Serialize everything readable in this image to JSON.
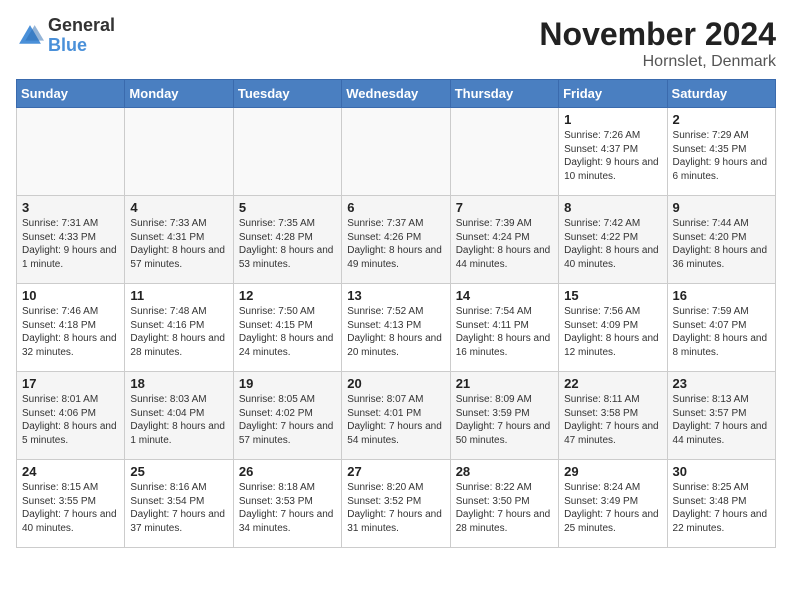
{
  "logo": {
    "general": "General",
    "blue": "Blue"
  },
  "title": "November 2024",
  "location": "Hornslet, Denmark",
  "weekdays": [
    "Sunday",
    "Monday",
    "Tuesday",
    "Wednesday",
    "Thursday",
    "Friday",
    "Saturday"
  ],
  "weeks": [
    [
      {
        "day": "",
        "info": ""
      },
      {
        "day": "",
        "info": ""
      },
      {
        "day": "",
        "info": ""
      },
      {
        "day": "",
        "info": ""
      },
      {
        "day": "",
        "info": ""
      },
      {
        "day": "1",
        "info": "Sunrise: 7:26 AM\nSunset: 4:37 PM\nDaylight: 9 hours and 10 minutes."
      },
      {
        "day": "2",
        "info": "Sunrise: 7:29 AM\nSunset: 4:35 PM\nDaylight: 9 hours and 6 minutes."
      }
    ],
    [
      {
        "day": "3",
        "info": "Sunrise: 7:31 AM\nSunset: 4:33 PM\nDaylight: 9 hours and 1 minute."
      },
      {
        "day": "4",
        "info": "Sunrise: 7:33 AM\nSunset: 4:31 PM\nDaylight: 8 hours and 57 minutes."
      },
      {
        "day": "5",
        "info": "Sunrise: 7:35 AM\nSunset: 4:28 PM\nDaylight: 8 hours and 53 minutes."
      },
      {
        "day": "6",
        "info": "Sunrise: 7:37 AM\nSunset: 4:26 PM\nDaylight: 8 hours and 49 minutes."
      },
      {
        "day": "7",
        "info": "Sunrise: 7:39 AM\nSunset: 4:24 PM\nDaylight: 8 hours and 44 minutes."
      },
      {
        "day": "8",
        "info": "Sunrise: 7:42 AM\nSunset: 4:22 PM\nDaylight: 8 hours and 40 minutes."
      },
      {
        "day": "9",
        "info": "Sunrise: 7:44 AM\nSunset: 4:20 PM\nDaylight: 8 hours and 36 minutes."
      }
    ],
    [
      {
        "day": "10",
        "info": "Sunrise: 7:46 AM\nSunset: 4:18 PM\nDaylight: 8 hours and 32 minutes."
      },
      {
        "day": "11",
        "info": "Sunrise: 7:48 AM\nSunset: 4:16 PM\nDaylight: 8 hours and 28 minutes."
      },
      {
        "day": "12",
        "info": "Sunrise: 7:50 AM\nSunset: 4:15 PM\nDaylight: 8 hours and 24 minutes."
      },
      {
        "day": "13",
        "info": "Sunrise: 7:52 AM\nSunset: 4:13 PM\nDaylight: 8 hours and 20 minutes."
      },
      {
        "day": "14",
        "info": "Sunrise: 7:54 AM\nSunset: 4:11 PM\nDaylight: 8 hours and 16 minutes."
      },
      {
        "day": "15",
        "info": "Sunrise: 7:56 AM\nSunset: 4:09 PM\nDaylight: 8 hours and 12 minutes."
      },
      {
        "day": "16",
        "info": "Sunrise: 7:59 AM\nSunset: 4:07 PM\nDaylight: 8 hours and 8 minutes."
      }
    ],
    [
      {
        "day": "17",
        "info": "Sunrise: 8:01 AM\nSunset: 4:06 PM\nDaylight: 8 hours and 5 minutes."
      },
      {
        "day": "18",
        "info": "Sunrise: 8:03 AM\nSunset: 4:04 PM\nDaylight: 8 hours and 1 minute."
      },
      {
        "day": "19",
        "info": "Sunrise: 8:05 AM\nSunset: 4:02 PM\nDaylight: 7 hours and 57 minutes."
      },
      {
        "day": "20",
        "info": "Sunrise: 8:07 AM\nSunset: 4:01 PM\nDaylight: 7 hours and 54 minutes."
      },
      {
        "day": "21",
        "info": "Sunrise: 8:09 AM\nSunset: 3:59 PM\nDaylight: 7 hours and 50 minutes."
      },
      {
        "day": "22",
        "info": "Sunrise: 8:11 AM\nSunset: 3:58 PM\nDaylight: 7 hours and 47 minutes."
      },
      {
        "day": "23",
        "info": "Sunrise: 8:13 AM\nSunset: 3:57 PM\nDaylight: 7 hours and 44 minutes."
      }
    ],
    [
      {
        "day": "24",
        "info": "Sunrise: 8:15 AM\nSunset: 3:55 PM\nDaylight: 7 hours and 40 minutes."
      },
      {
        "day": "25",
        "info": "Sunrise: 8:16 AM\nSunset: 3:54 PM\nDaylight: 7 hours and 37 minutes."
      },
      {
        "day": "26",
        "info": "Sunrise: 8:18 AM\nSunset: 3:53 PM\nDaylight: 7 hours and 34 minutes."
      },
      {
        "day": "27",
        "info": "Sunrise: 8:20 AM\nSunset: 3:52 PM\nDaylight: 7 hours and 31 minutes."
      },
      {
        "day": "28",
        "info": "Sunrise: 8:22 AM\nSunset: 3:50 PM\nDaylight: 7 hours and 28 minutes."
      },
      {
        "day": "29",
        "info": "Sunrise: 8:24 AM\nSunset: 3:49 PM\nDaylight: 7 hours and 25 minutes."
      },
      {
        "day": "30",
        "info": "Sunrise: 8:25 AM\nSunset: 3:48 PM\nDaylight: 7 hours and 22 minutes."
      }
    ]
  ]
}
